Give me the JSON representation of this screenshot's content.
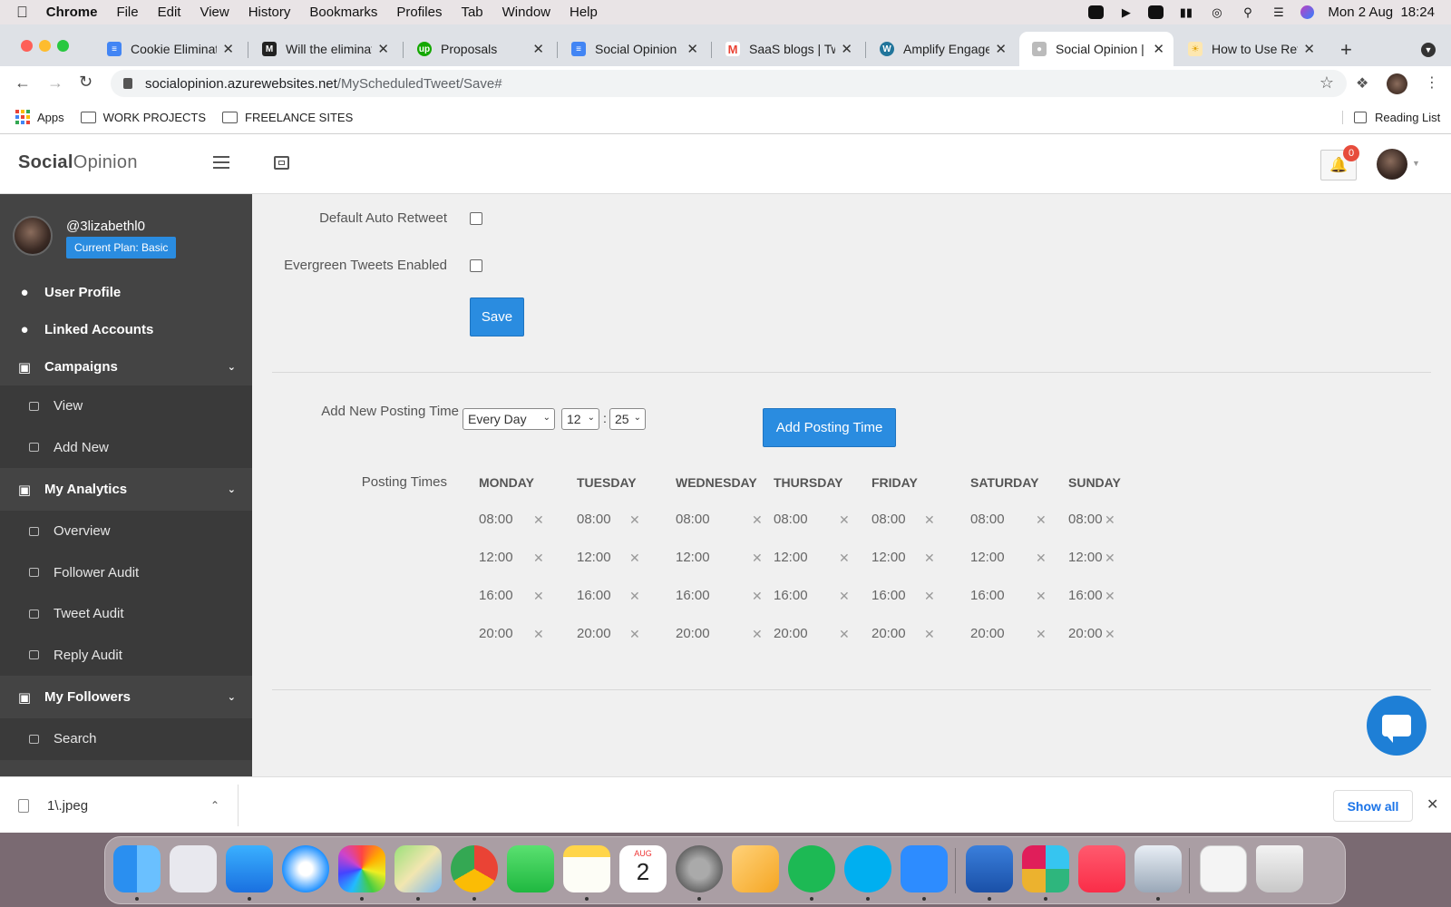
{
  "menubar": {
    "app": "Chrome",
    "items": [
      "File",
      "Edit",
      "View",
      "History",
      "Bookmarks",
      "Profiles",
      "Tab",
      "Window",
      "Help"
    ],
    "datetime": "Mon 2 Aug  18:24"
  },
  "tabs": [
    {
      "title": "Cookie Eliminat",
      "icon": "docs-icon",
      "color": "#4285f4"
    },
    {
      "title": "Will the eliminat",
      "icon": "site-icon",
      "color": "#222"
    },
    {
      "title": "Proposals",
      "icon": "upwork-icon",
      "color": "#14a800"
    },
    {
      "title": "Social Opinion (",
      "icon": "docs-icon",
      "color": "#4285f4"
    },
    {
      "title": "SaaS blogs | Tw",
      "icon": "gmail-icon",
      "color": "#ea4335"
    },
    {
      "title": "Amplify Engage",
      "icon": "wordpress-icon",
      "color": "#21759b"
    },
    {
      "title": "Social Opinion |",
      "icon": "socialopinion-icon",
      "color": "#888",
      "active": true
    },
    {
      "title": "How to Use Ret",
      "icon": "bulb-icon",
      "color": "#f4b400"
    }
  ],
  "address": {
    "host": "socialopinion.azurewebsites.net",
    "path": "/MyScheduledTweet/Save#"
  },
  "bookmarks": {
    "apps": "Apps",
    "items": [
      "WORK PROJECTS",
      "FREELANCE SITES"
    ],
    "reading_list": "Reading List"
  },
  "header": {
    "brand_bold": "Social",
    "brand_light": "Opinion",
    "notif_count": "0"
  },
  "sidebar": {
    "handle": "@3lizabethl0",
    "plan": "Current Plan: Basic",
    "items": [
      {
        "label": "User Profile"
      },
      {
        "label": "Linked Accounts"
      },
      {
        "label": "Campaigns"
      },
      {
        "label": "My Analytics"
      },
      {
        "label": "My Followers"
      }
    ],
    "campaigns_sub": [
      "View",
      "Add New"
    ],
    "analytics_sub": [
      "Overview",
      "Follower Audit",
      "Tweet Audit",
      "Reply Audit"
    ],
    "followers_sub": [
      "Search"
    ]
  },
  "form": {
    "auto_retweet_label": "Default Auto Retweet",
    "evergreen_label": "Evergreen Tweets Enabled",
    "save_label": "Save",
    "add_time_label": "Add New Posting Time",
    "frequency": "Every Day",
    "hour": "12",
    "colon": ":",
    "minute": "25",
    "add_button": "Add Posting Time",
    "posting_times_label": "Posting Times"
  },
  "schedule": {
    "days": [
      "MONDAY",
      "TUESDAY",
      "WEDNESDAY",
      "THURSDAY",
      "FRIDAY",
      "SATURDAY",
      "SUNDAY"
    ],
    "times": [
      "08:00",
      "12:00",
      "16:00",
      "20:00"
    ],
    "remove_glyph": "✕"
  },
  "downloads": {
    "file": "1\\.jpeg",
    "show_all": "Show all"
  },
  "dock": {
    "calendar_month": "AUG",
    "calendar_day": "2"
  }
}
